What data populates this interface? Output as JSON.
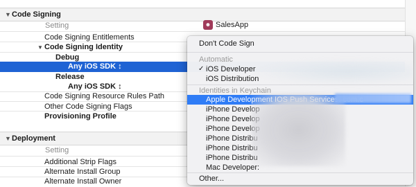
{
  "sections": {
    "code_signing": "Code Signing",
    "deployment": "Deployment"
  },
  "column_header": "Setting",
  "target": {
    "name": "SalesApp",
    "icon": "app-icon"
  },
  "code_signing_rows": {
    "entitlements": "Code Signing Entitlements",
    "identity": "Code Signing Identity",
    "debug": "Debug",
    "debug_value": "Any iOS SDK ↕",
    "release": "Release",
    "release_value": "Any iOS SDK ↕",
    "resource_rules": "Code Signing Resource Rules Path",
    "other_flags": "Other Code Signing Flags",
    "provisioning": "Provisioning Profile"
  },
  "deployment_rows": {
    "strip_flags": "Additional Strip Flags",
    "install_group": "Alternate Install Group",
    "install_owner": "Alternate Install Owner"
  },
  "menu": {
    "dont_sign": "Don't Code Sign",
    "automatic_header": "Automatic",
    "ios_developer": "iOS Developer",
    "ios_distribution": "iOS Distribution",
    "keychain_header": "Identities in Keychain",
    "identities": [
      "Apple Development IOS Push Services: com.c",
      "iPhone Develop",
      "iPhone Develop",
      "iPhone Develop",
      "iPhone Distribu",
      "iPhone Distribu",
      "iPhone Distribu",
      "Mac Developer:"
    ],
    "other": "Other...",
    "checkmark": "✓"
  },
  "colors": {
    "selection": "#1f63d4",
    "menu_highlight": "#2f7cf6"
  }
}
